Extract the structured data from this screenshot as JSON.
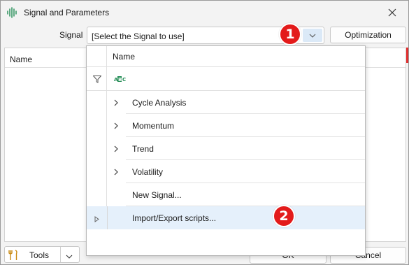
{
  "window": {
    "title": "Signal and Parameters",
    "app_icon": "signal-bars-icon",
    "close_icon": "close-icon"
  },
  "signal": {
    "label": "Signal",
    "value": "[Select the Signal to use]"
  },
  "optimization_label": "Optimization",
  "grid": {
    "name_header": "Name"
  },
  "popup": {
    "header": "Name",
    "items": [
      {
        "label": "Cycle Analysis",
        "expandable": true
      },
      {
        "label": "Momentum",
        "expandable": true
      },
      {
        "label": "Trend",
        "expandable": true
      },
      {
        "label": "Volatility",
        "expandable": true
      },
      {
        "label": "New Signal...",
        "expandable": false
      },
      {
        "label": "Import/Export scripts...",
        "expandable": false,
        "selected": true
      }
    ]
  },
  "bottom": {
    "tools_label": "Tools",
    "ok_label": "OK",
    "cancel_label": "Cancel"
  },
  "badges": [
    "1",
    "2"
  ],
  "colors": {
    "badge": "#e31b1b",
    "selected_row": "#e5f0fb",
    "combo_button": "#dbe9f7",
    "abc_icon": "#1f8a52"
  }
}
